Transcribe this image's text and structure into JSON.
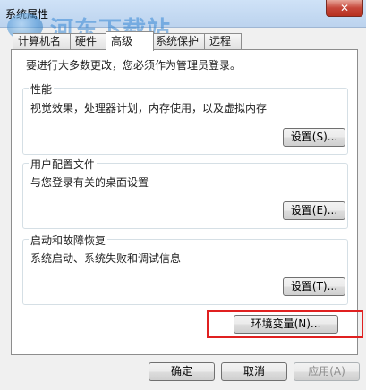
{
  "window": {
    "title": "系统属性",
    "close_icon": "✕"
  },
  "watermark": {
    "brand": "河东下载站",
    "url": "www.pc0359.cn"
  },
  "tabs": [
    {
      "label": "计算机名"
    },
    {
      "label": "硬件"
    },
    {
      "label": "高级"
    },
    {
      "label": "系统保护"
    },
    {
      "label": "远程"
    }
  ],
  "intro_text": "要进行大多数更改，您必须作为管理员登录。",
  "performance": {
    "title": "性能",
    "desc": "视觉效果，处理器计划，内存使用，以及虚拟内存",
    "button": "设置(S)..."
  },
  "user_profiles": {
    "title": "用户配置文件",
    "desc": "与您登录有关的桌面设置",
    "button": "设置(E)..."
  },
  "startup": {
    "title": "启动和故障恢复",
    "desc": "系统启动、系统失败和调试信息",
    "button": "设置(T)..."
  },
  "env_button": "环境变量(N)...",
  "footer": {
    "ok": "确定",
    "cancel": "取消",
    "apply": "应用(A)"
  },
  "colors": {
    "highlight": "#e02020"
  }
}
